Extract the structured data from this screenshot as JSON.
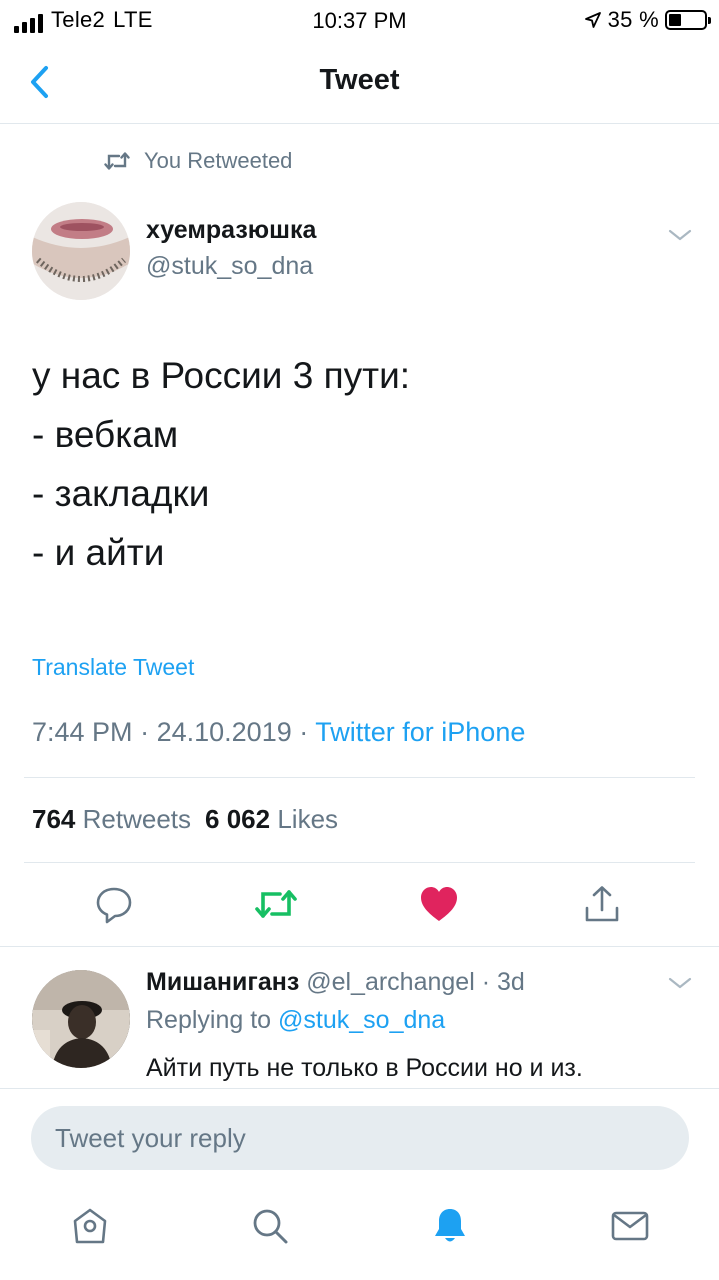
{
  "status_bar": {
    "carrier": "Tele2",
    "network": "LTE",
    "time": "10:37 PM",
    "battery_text": "35 %",
    "battery_level": 0.35,
    "icons": [
      "signal-bars-icon",
      "location-arrow-icon",
      "battery-icon"
    ]
  },
  "header": {
    "title": "Tweet",
    "back_icon": "chevron-left-icon"
  },
  "retweet_context": {
    "icon": "retweet-icon",
    "text": "You Retweeted"
  },
  "tweet": {
    "author_name": "хуемразюшка",
    "author_handle": "@stuk_so_dna",
    "lines": [
      "у нас в России 3 пути:",
      "- вебкам",
      "- закладки",
      "- и айти"
    ],
    "translate_label": "Translate Tweet",
    "time": "7:44 PM",
    "separator": "·",
    "date": "24.10.2019",
    "source": "Twitter for iPhone",
    "retweets_count": "764",
    "retweets_label": "Retweets",
    "likes_count": "6 062",
    "likes_label": "Likes",
    "actions": [
      "reply-icon",
      "retweet-icon",
      "heart-icon",
      "share-icon"
    ]
  },
  "colors": {
    "accent": "#1da1f2",
    "secondary_text": "#657786",
    "retweet_active": "#17bf63",
    "like_active": "#e0245e"
  },
  "reply": {
    "author_name": "Мишаниганз",
    "author_handle": "@el_archangel",
    "separator": "·",
    "age": "3d",
    "replying_to_label": "Replying to",
    "replying_to_handle": "@stuk_so_dna",
    "text": "Айти путь не только в России но и из."
  },
  "composer": {
    "placeholder": "Tweet your reply"
  },
  "tab_bar": {
    "items": [
      "home-icon",
      "search-icon",
      "notifications-icon",
      "messages-icon"
    ],
    "active": "notifications-icon"
  }
}
